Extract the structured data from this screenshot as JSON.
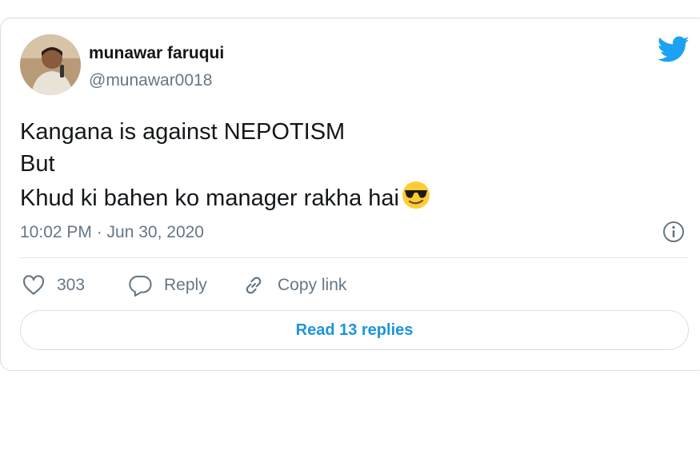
{
  "tweet": {
    "author_name": "munawar faruqui",
    "author_handle": "@munawar0018",
    "text_lines": [
      "Kangana is against NEPOTISM",
      "But",
      "Khud ki bahen ko manager rakha hai"
    ],
    "timestamp": "10:02 PM · Jun 30, 2020",
    "like_count": "303",
    "reply_label": "Reply",
    "copy_link_label": "Copy link",
    "read_replies_label": "Read 13 replies"
  },
  "icons": {
    "brand": "twitter-bird-icon",
    "emoji": "sunglasses-emoji",
    "like": "heart-icon",
    "reply": "reply-bubble-icon",
    "copy": "link-icon",
    "info": "info-icon"
  },
  "colors": {
    "brand_blue": "#1da1f2",
    "link_blue": "#1b95e0",
    "muted_text": "#657786",
    "border": "#d9dde1"
  }
}
